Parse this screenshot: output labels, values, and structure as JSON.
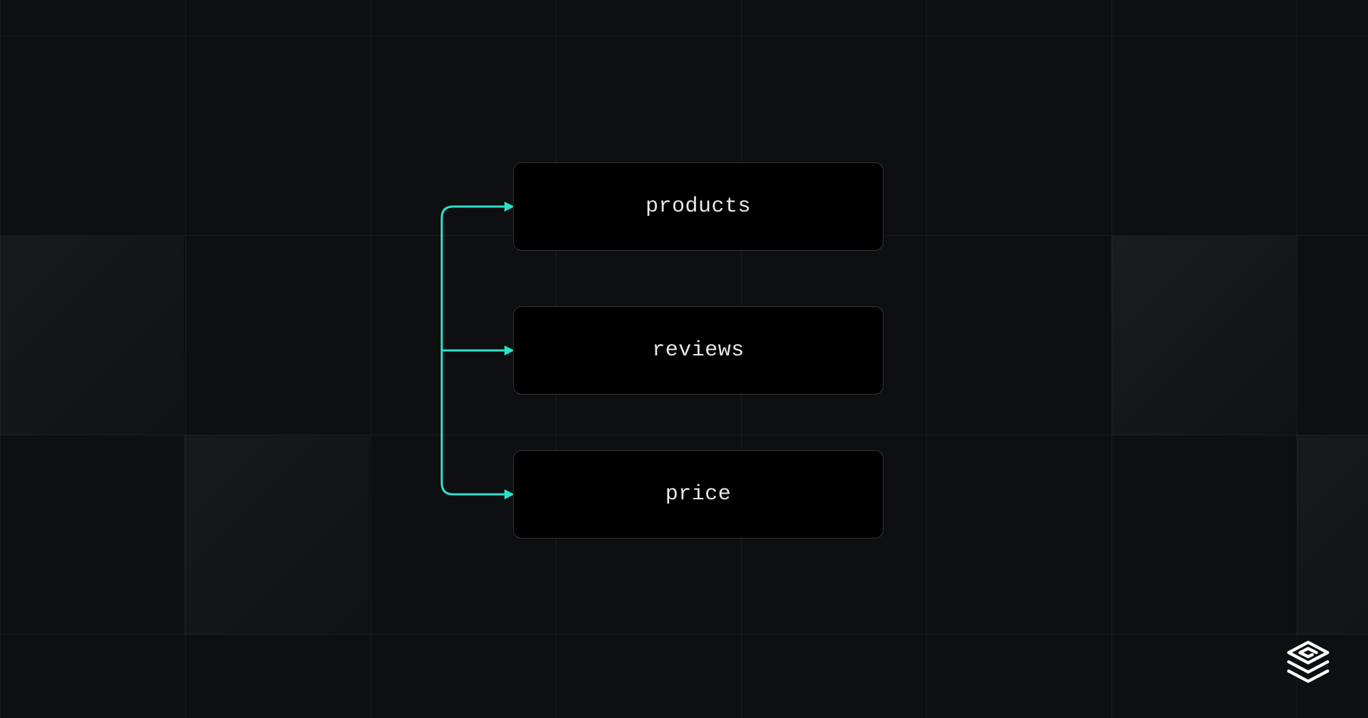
{
  "diagram": {
    "nodes": [
      {
        "label": "products"
      },
      {
        "label": "reviews"
      },
      {
        "label": "price"
      }
    ],
    "accent_color": "#2ce0c8"
  }
}
